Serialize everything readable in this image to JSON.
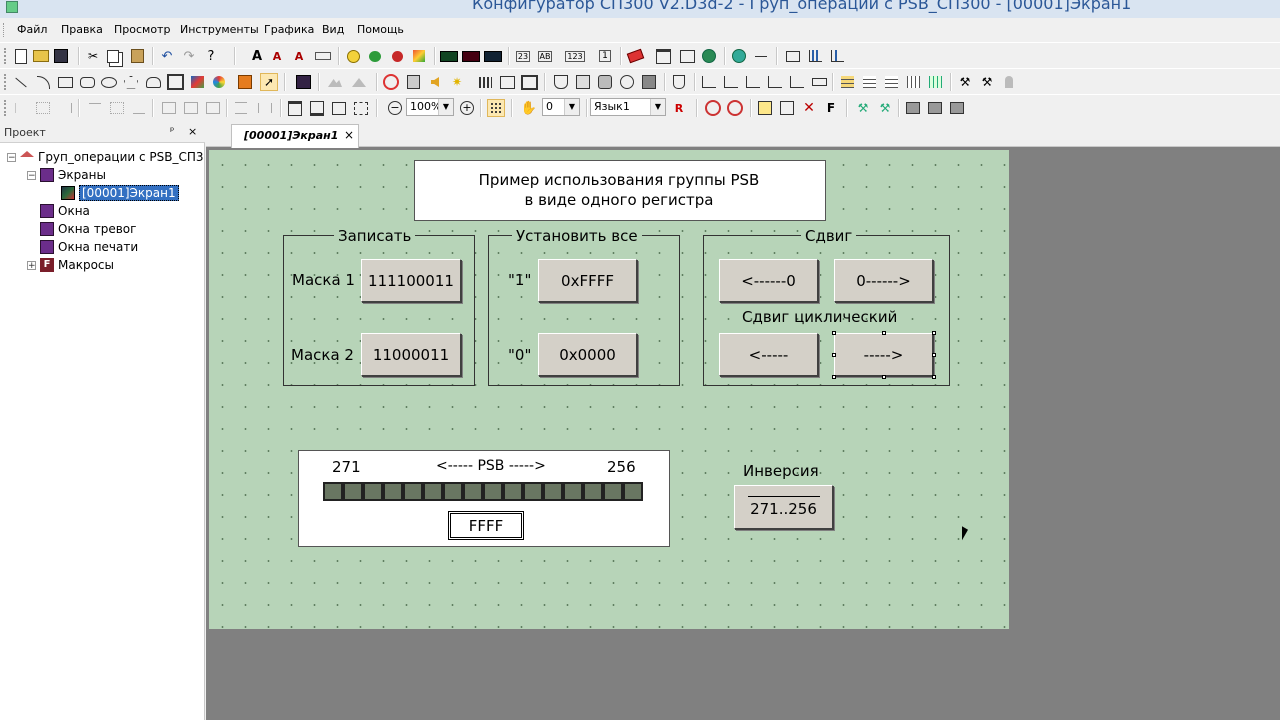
{
  "window": {
    "title": "Конфигуратор СП300 V2.D3d-2 - Груп_операции с PSB_СП300 - [00001]Экран1"
  },
  "menu": [
    "Файл",
    "Правка",
    "Просмотр",
    "Инструменты",
    "Графика",
    "Вид",
    "Помощь"
  ],
  "toolbar": {
    "zoom_value": "100%",
    "layer_value": "0",
    "language_value": "Язык1"
  },
  "project": {
    "header": "Проект",
    "root": "Груп_операции с PSB_СП3",
    "screens": "Экраны",
    "screen1": "[00001]Экран1",
    "windows": "Окна",
    "alarm_windows": "Окна тревог",
    "print_windows": "Окна печати",
    "macros": "Макросы"
  },
  "tab": {
    "label": "[00001]Экран1",
    "close": "×"
  },
  "screen": {
    "title_line1": "Пример использования группы PSB",
    "title_line2": "в виде одного регистра",
    "write_group": {
      "title": "Записать",
      "mask1_label": "Маска 1",
      "mask1_value": "111100011",
      "mask2_label": "Маска 2",
      "mask2_value": "11000011"
    },
    "setall_group": {
      "title": "Установить все",
      "one_label": "\"1\"",
      "one_button": "0xFFFF",
      "zero_label": "\"0\"",
      "zero_button": "0x0000"
    },
    "shift_group": {
      "title": "Сдвиг",
      "shift_left": "<------0",
      "shift_right": "0------>",
      "cyclic_title": "Сдвиг циклический",
      "cyc_left": "<-----",
      "cyc_right": "----->"
    },
    "psb_panel": {
      "left_label": "271",
      "center_label": "<----- PSB ----->",
      "right_label": "256",
      "cell_count": 16,
      "value": "FFFF"
    },
    "inversion": {
      "label": "Инверсия",
      "button": "271..256"
    }
  }
}
